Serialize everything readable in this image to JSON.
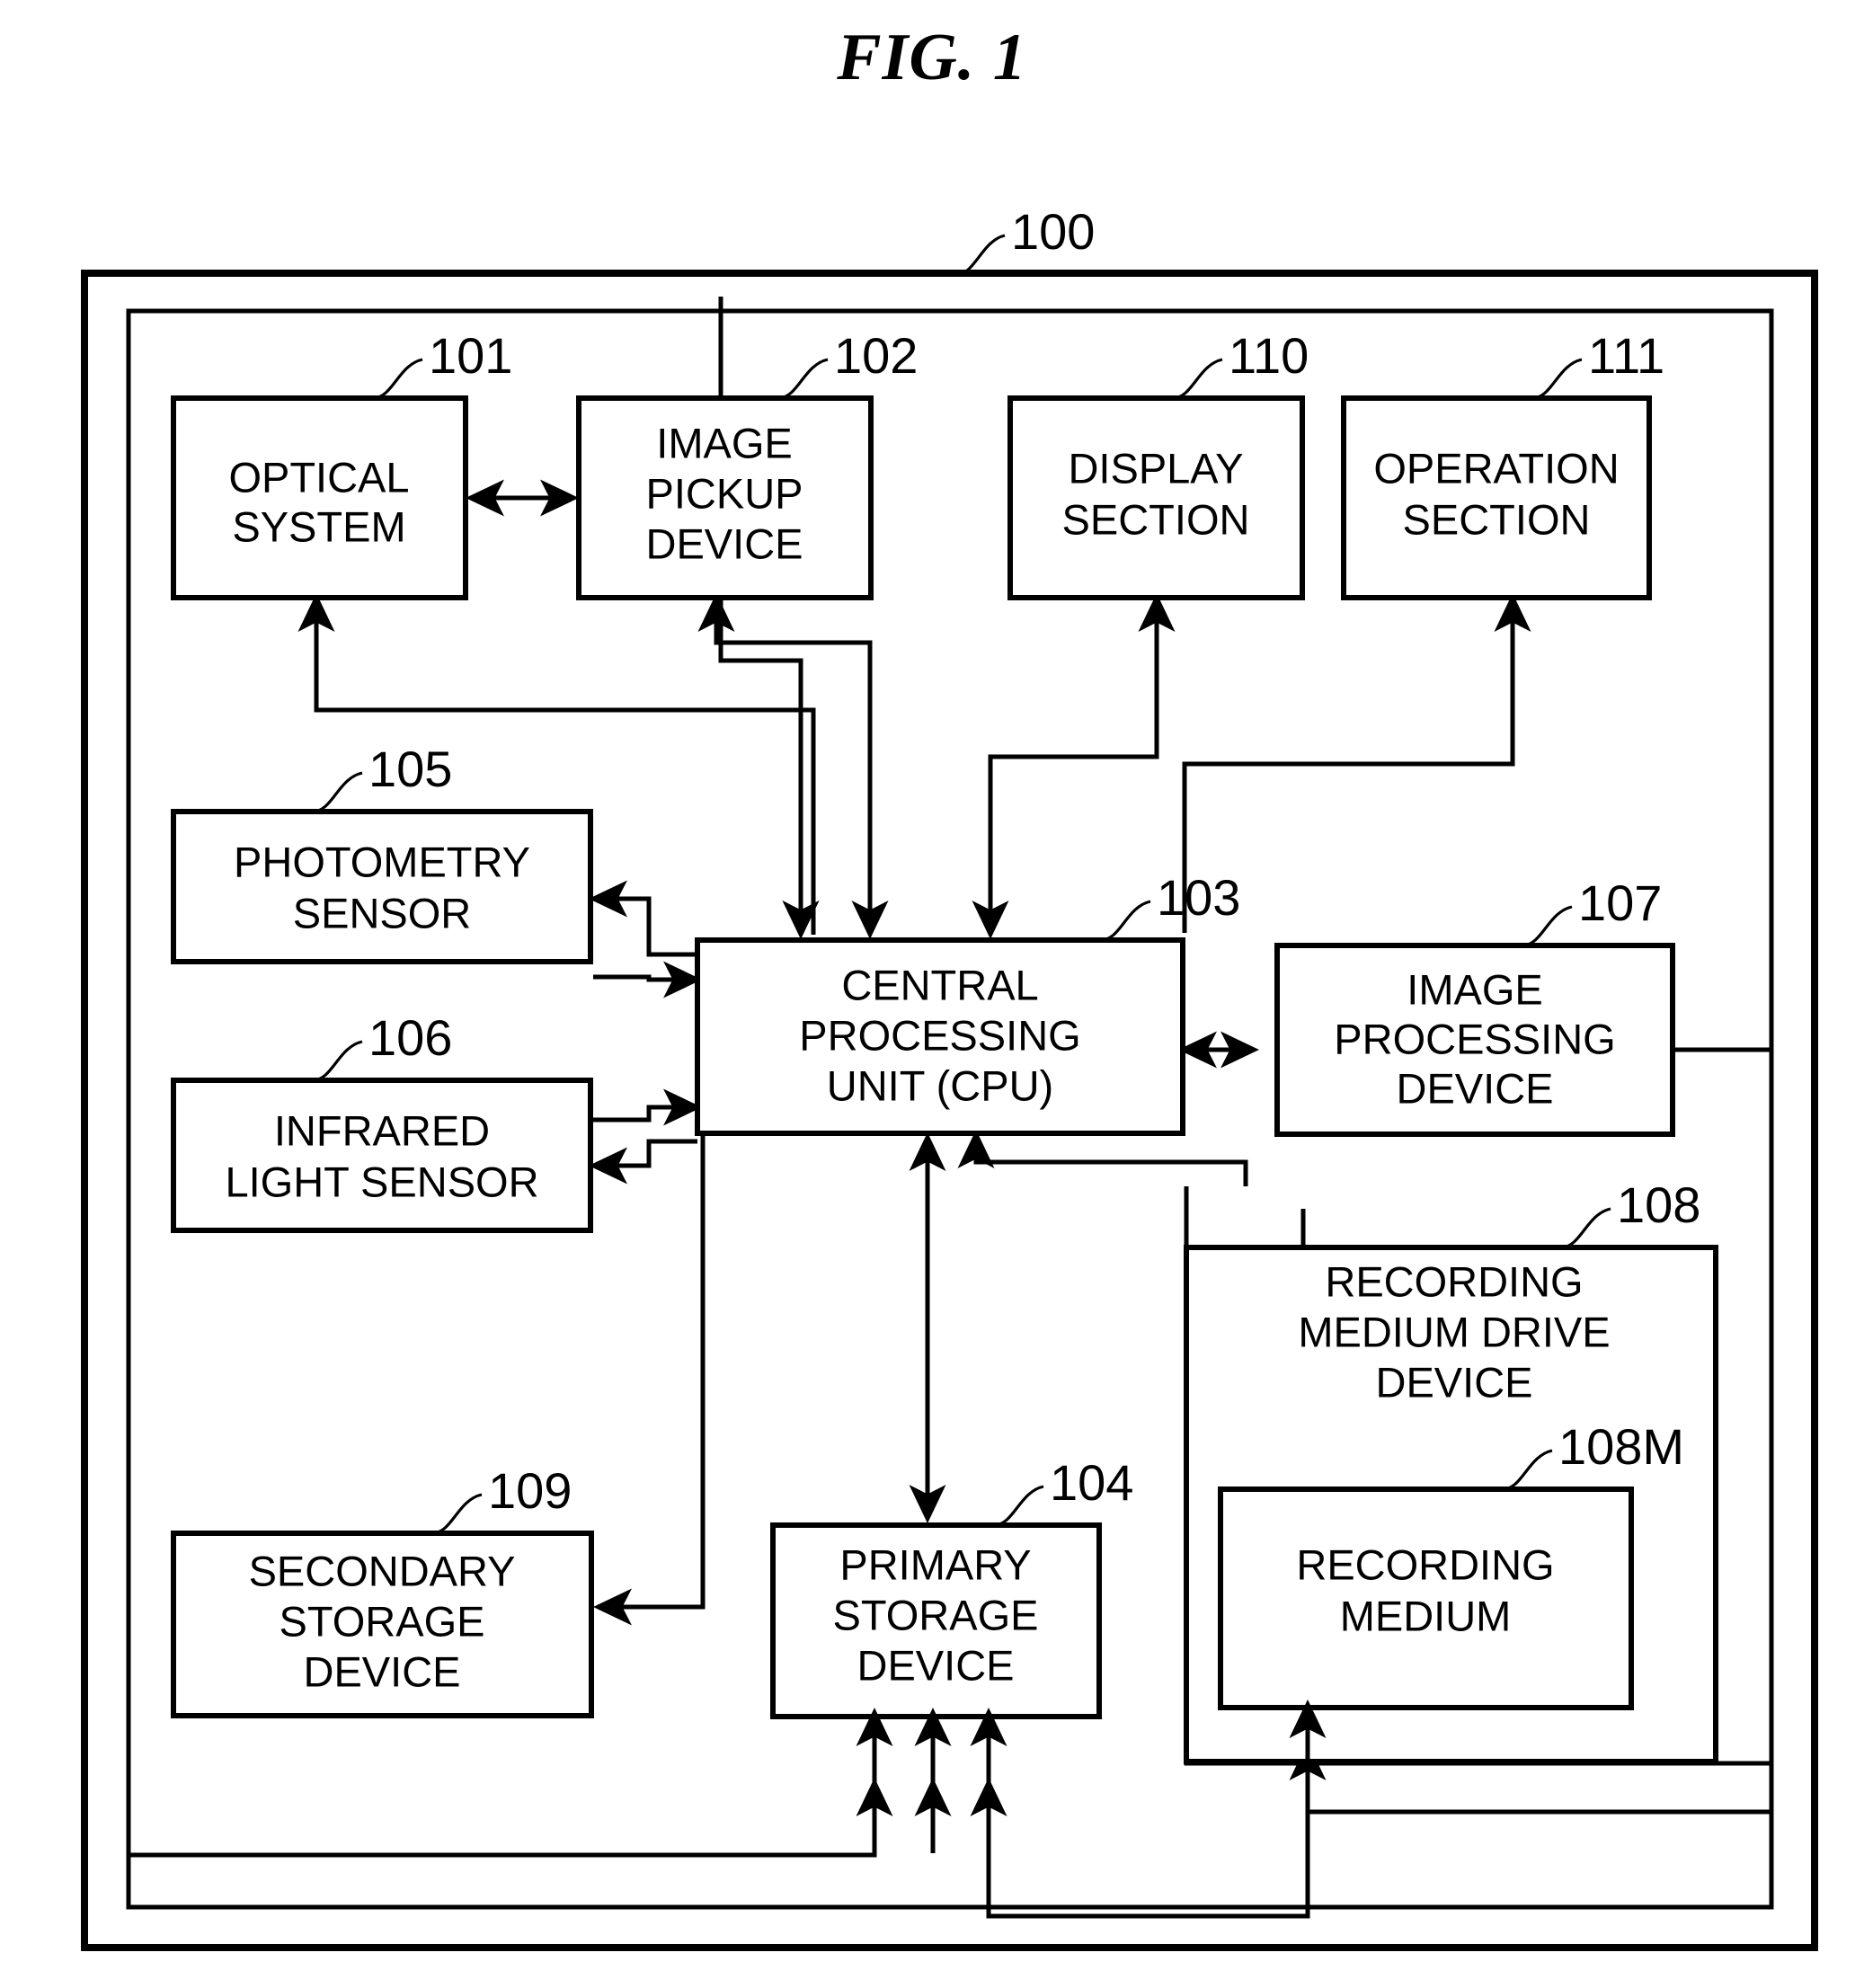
{
  "figure": {
    "title": "FIG. 1",
    "type": "block-diagram",
    "caption_ref": "100"
  },
  "refs": {
    "device": "100",
    "optical_system": "101",
    "image_pickup_device": "102",
    "cpu": "103",
    "primary_storage": "104",
    "photometry_sensor": "105",
    "infrared_light_sensor": "106",
    "image_processing_device": "107",
    "recording_medium_drive": "108",
    "recording_medium": "108M",
    "secondary_storage": "109",
    "display_section": "110",
    "operation_section": "111"
  },
  "blocks": {
    "optical_system": {
      "lines": [
        "OPTICAL",
        "SYSTEM"
      ],
      "ref": "101"
    },
    "image_pickup_device": {
      "lines": [
        "IMAGE",
        "PICKUP",
        "DEVICE"
      ],
      "ref": "102"
    },
    "display_section": {
      "lines": [
        "DISPLAY",
        "SECTION"
      ],
      "ref": "110"
    },
    "operation_section": {
      "lines": [
        "OPERATION",
        "SECTION"
      ],
      "ref": "111"
    },
    "photometry_sensor": {
      "lines": [
        "PHOTOMETRY",
        "SENSOR"
      ],
      "ref": "105"
    },
    "infrared_light_sensor": {
      "lines": [
        "INFRARED",
        "LIGHT SENSOR"
      ],
      "ref": "106"
    },
    "cpu": {
      "lines": [
        "CENTRAL",
        "PROCESSING",
        "UNIT (CPU)"
      ],
      "ref": "103"
    },
    "image_processing_device": {
      "lines": [
        "IMAGE",
        "PROCESSING",
        "DEVICE"
      ],
      "ref": "107"
    },
    "recording_medium_drive": {
      "lines": [
        "RECORDING",
        "MEDIUM DRIVE",
        "DEVICE"
      ],
      "ref": "108"
    },
    "recording_medium": {
      "lines": [
        "RECORDING",
        "MEDIUM"
      ],
      "ref": "108M"
    },
    "secondary_storage": {
      "lines": [
        "SECONDARY",
        "STORAGE",
        "DEVICE"
      ],
      "ref": "109"
    },
    "primary_storage": {
      "lines": [
        "PRIMARY",
        "STORAGE",
        "DEVICE"
      ],
      "ref": "104"
    }
  },
  "colors": {
    "ink": "#000000",
    "paper": "#ffffff"
  }
}
